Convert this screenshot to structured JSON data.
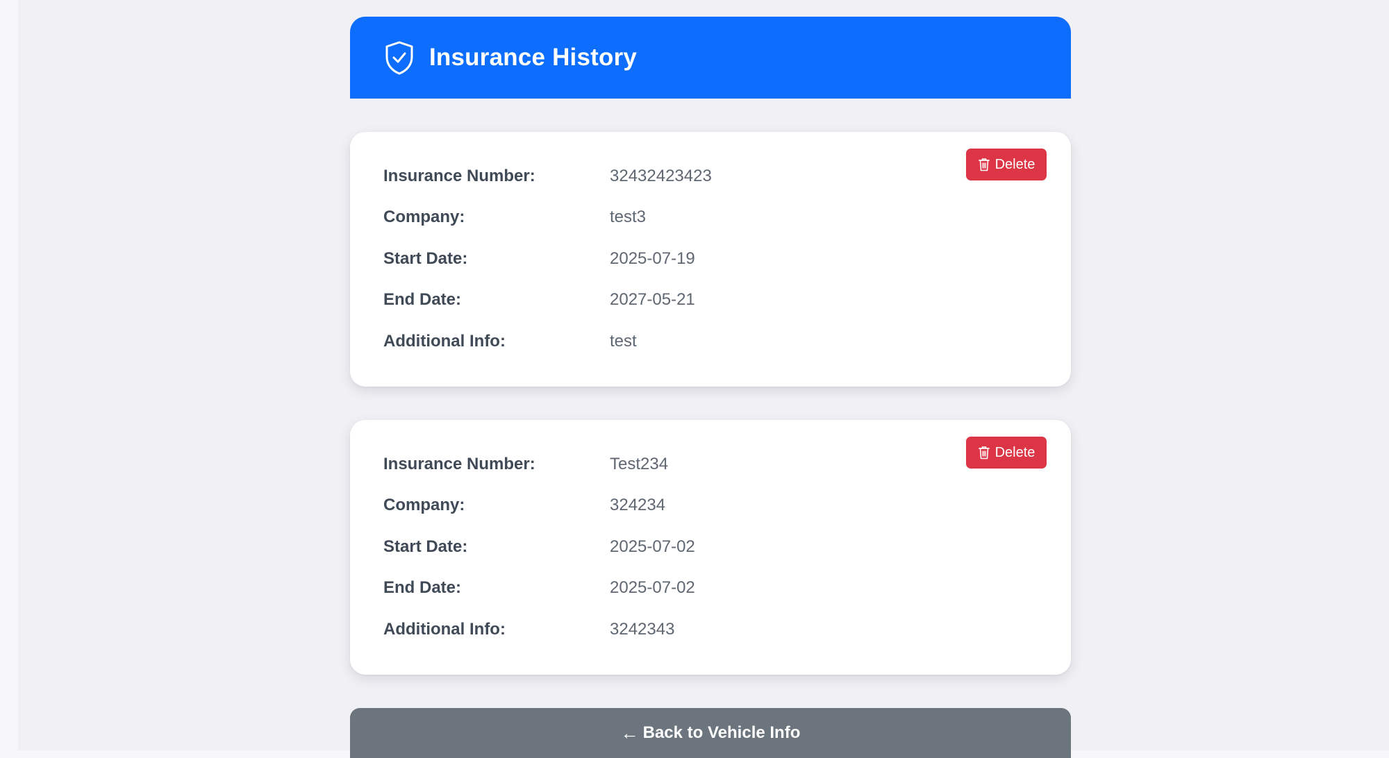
{
  "header": {
    "title": "Insurance History",
    "icon": "shield-check-icon"
  },
  "records": [
    {
      "delete_label": "Delete",
      "fields": [
        {
          "label": "Insurance Number:",
          "value": "32432423423"
        },
        {
          "label": "Company:",
          "value": "test3"
        },
        {
          "label": "Start Date:",
          "value": "2025-07-19"
        },
        {
          "label": "End Date:",
          "value": "2027-05-21"
        },
        {
          "label": "Additional Info:",
          "value": "test"
        }
      ]
    },
    {
      "delete_label": "Delete",
      "fields": [
        {
          "label": "Insurance Number:",
          "value": "Test234"
        },
        {
          "label": "Company:",
          "value": "324234"
        },
        {
          "label": "Start Date:",
          "value": "2025-07-02"
        },
        {
          "label": "End Date:",
          "value": "2025-07-02"
        },
        {
          "label": "Additional Info:",
          "value": "3242343"
        }
      ]
    }
  ],
  "back_button": {
    "arrow": "←",
    "label": "Back to Vehicle Info"
  },
  "colors": {
    "header_bg": "#0d6efd",
    "delete_bg": "#dc3545",
    "back_bg": "#6c757d",
    "page_bg": "#f0f0f5"
  }
}
